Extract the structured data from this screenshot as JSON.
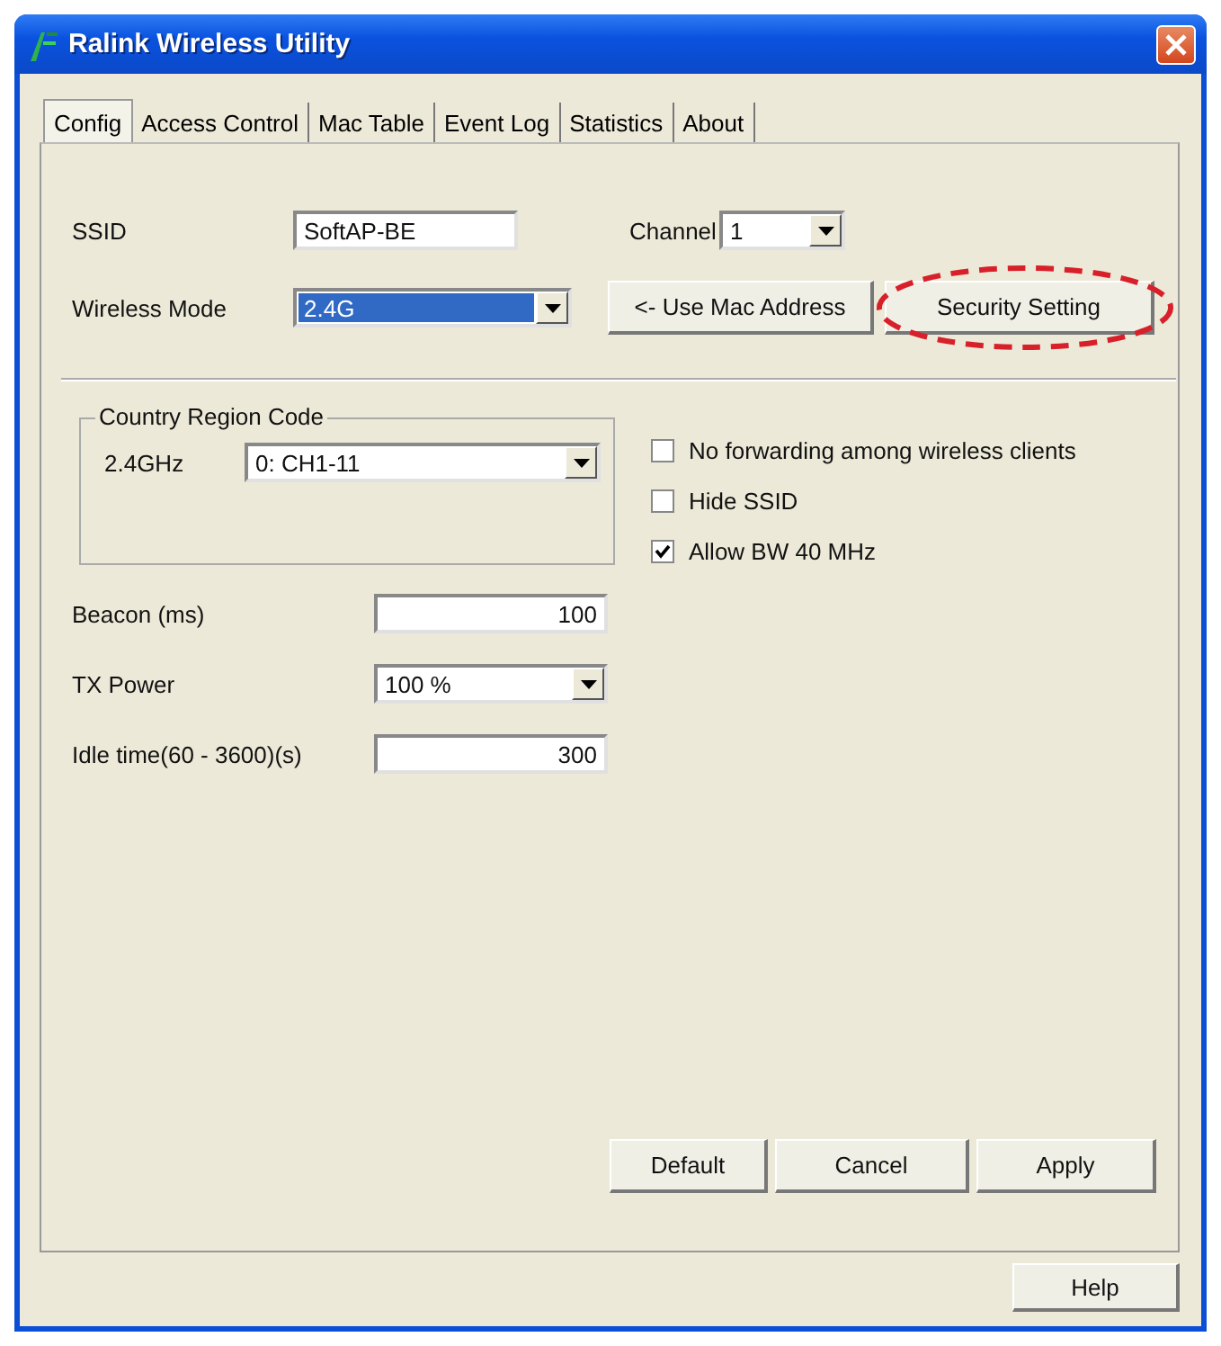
{
  "window": {
    "title": "Ralink Wireless Utility"
  },
  "tabs": [
    {
      "label": "Config",
      "selected": true
    },
    {
      "label": "Access Control",
      "selected": false
    },
    {
      "label": "Mac Table",
      "selected": false
    },
    {
      "label": "Event Log",
      "selected": false
    },
    {
      "label": "Statistics",
      "selected": false
    },
    {
      "label": "About",
      "selected": false
    }
  ],
  "ssid": {
    "label": "SSID",
    "value": "SoftAP-BE"
  },
  "channel": {
    "label": "Channel",
    "value": "1"
  },
  "wireless_mode": {
    "label": "Wireless Mode",
    "value": "2.4G",
    "focused": true
  },
  "top_buttons": [
    {
      "label": "<- Use Mac Address",
      "circled": false
    },
    {
      "label": "Security Setting",
      "circled": true
    }
  ],
  "country_region": {
    "title": "Country Region Code",
    "label": "2.4GHz",
    "value": "0: CH1-11"
  },
  "options": [
    {
      "label": "No forwarding among wireless clients",
      "checked": false
    },
    {
      "label": "Hide SSID",
      "checked": false
    },
    {
      "label": "Allow BW 40 MHz",
      "checked": true
    }
  ],
  "fields": [
    {
      "kind": "text",
      "label": "Beacon (ms)",
      "value": "100"
    },
    {
      "kind": "select",
      "label": "TX Power",
      "value": "100 %"
    },
    {
      "kind": "text",
      "label": "Idle time(60 - 3600)(s)",
      "value": "300"
    }
  ],
  "actions": [
    "Default",
    "Cancel",
    "Apply"
  ],
  "help_button": "Help"
}
